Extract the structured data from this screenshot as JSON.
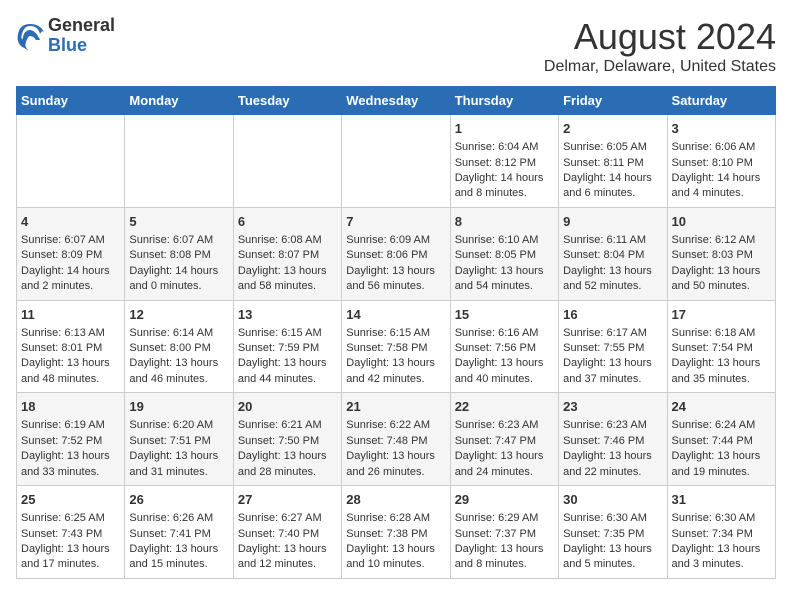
{
  "header": {
    "logo_general": "General",
    "logo_blue": "Blue",
    "main_title": "August 2024",
    "subtitle": "Delmar, Delaware, United States"
  },
  "weekdays": [
    "Sunday",
    "Monday",
    "Tuesday",
    "Wednesday",
    "Thursday",
    "Friday",
    "Saturday"
  ],
  "weeks": [
    [
      {
        "day": "",
        "content": ""
      },
      {
        "day": "",
        "content": ""
      },
      {
        "day": "",
        "content": ""
      },
      {
        "day": "",
        "content": ""
      },
      {
        "day": "1",
        "content": "Sunrise: 6:04 AM\nSunset: 8:12 PM\nDaylight: 14 hours\nand 8 minutes."
      },
      {
        "day": "2",
        "content": "Sunrise: 6:05 AM\nSunset: 8:11 PM\nDaylight: 14 hours\nand 6 minutes."
      },
      {
        "day": "3",
        "content": "Sunrise: 6:06 AM\nSunset: 8:10 PM\nDaylight: 14 hours\nand 4 minutes."
      }
    ],
    [
      {
        "day": "4",
        "content": "Sunrise: 6:07 AM\nSunset: 8:09 PM\nDaylight: 14 hours\nand 2 minutes."
      },
      {
        "day": "5",
        "content": "Sunrise: 6:07 AM\nSunset: 8:08 PM\nDaylight: 14 hours\nand 0 minutes."
      },
      {
        "day": "6",
        "content": "Sunrise: 6:08 AM\nSunset: 8:07 PM\nDaylight: 13 hours\nand 58 minutes."
      },
      {
        "day": "7",
        "content": "Sunrise: 6:09 AM\nSunset: 8:06 PM\nDaylight: 13 hours\nand 56 minutes."
      },
      {
        "day": "8",
        "content": "Sunrise: 6:10 AM\nSunset: 8:05 PM\nDaylight: 13 hours\nand 54 minutes."
      },
      {
        "day": "9",
        "content": "Sunrise: 6:11 AM\nSunset: 8:04 PM\nDaylight: 13 hours\nand 52 minutes."
      },
      {
        "day": "10",
        "content": "Sunrise: 6:12 AM\nSunset: 8:03 PM\nDaylight: 13 hours\nand 50 minutes."
      }
    ],
    [
      {
        "day": "11",
        "content": "Sunrise: 6:13 AM\nSunset: 8:01 PM\nDaylight: 13 hours\nand 48 minutes."
      },
      {
        "day": "12",
        "content": "Sunrise: 6:14 AM\nSunset: 8:00 PM\nDaylight: 13 hours\nand 46 minutes."
      },
      {
        "day": "13",
        "content": "Sunrise: 6:15 AM\nSunset: 7:59 PM\nDaylight: 13 hours\nand 44 minutes."
      },
      {
        "day": "14",
        "content": "Sunrise: 6:15 AM\nSunset: 7:58 PM\nDaylight: 13 hours\nand 42 minutes."
      },
      {
        "day": "15",
        "content": "Sunrise: 6:16 AM\nSunset: 7:56 PM\nDaylight: 13 hours\nand 40 minutes."
      },
      {
        "day": "16",
        "content": "Sunrise: 6:17 AM\nSunset: 7:55 PM\nDaylight: 13 hours\nand 37 minutes."
      },
      {
        "day": "17",
        "content": "Sunrise: 6:18 AM\nSunset: 7:54 PM\nDaylight: 13 hours\nand 35 minutes."
      }
    ],
    [
      {
        "day": "18",
        "content": "Sunrise: 6:19 AM\nSunset: 7:52 PM\nDaylight: 13 hours\nand 33 minutes."
      },
      {
        "day": "19",
        "content": "Sunrise: 6:20 AM\nSunset: 7:51 PM\nDaylight: 13 hours\nand 31 minutes."
      },
      {
        "day": "20",
        "content": "Sunrise: 6:21 AM\nSunset: 7:50 PM\nDaylight: 13 hours\nand 28 minutes."
      },
      {
        "day": "21",
        "content": "Sunrise: 6:22 AM\nSunset: 7:48 PM\nDaylight: 13 hours\nand 26 minutes."
      },
      {
        "day": "22",
        "content": "Sunrise: 6:23 AM\nSunset: 7:47 PM\nDaylight: 13 hours\nand 24 minutes."
      },
      {
        "day": "23",
        "content": "Sunrise: 6:23 AM\nSunset: 7:46 PM\nDaylight: 13 hours\nand 22 minutes."
      },
      {
        "day": "24",
        "content": "Sunrise: 6:24 AM\nSunset: 7:44 PM\nDaylight: 13 hours\nand 19 minutes."
      }
    ],
    [
      {
        "day": "25",
        "content": "Sunrise: 6:25 AM\nSunset: 7:43 PM\nDaylight: 13 hours\nand 17 minutes."
      },
      {
        "day": "26",
        "content": "Sunrise: 6:26 AM\nSunset: 7:41 PM\nDaylight: 13 hours\nand 15 minutes."
      },
      {
        "day": "27",
        "content": "Sunrise: 6:27 AM\nSunset: 7:40 PM\nDaylight: 13 hours\nand 12 minutes."
      },
      {
        "day": "28",
        "content": "Sunrise: 6:28 AM\nSunset: 7:38 PM\nDaylight: 13 hours\nand 10 minutes."
      },
      {
        "day": "29",
        "content": "Sunrise: 6:29 AM\nSunset: 7:37 PM\nDaylight: 13 hours\nand 8 minutes."
      },
      {
        "day": "30",
        "content": "Sunrise: 6:30 AM\nSunset: 7:35 PM\nDaylight: 13 hours\nand 5 minutes."
      },
      {
        "day": "31",
        "content": "Sunrise: 6:30 AM\nSunset: 7:34 PM\nDaylight: 13 hours\nand 3 minutes."
      }
    ]
  ]
}
